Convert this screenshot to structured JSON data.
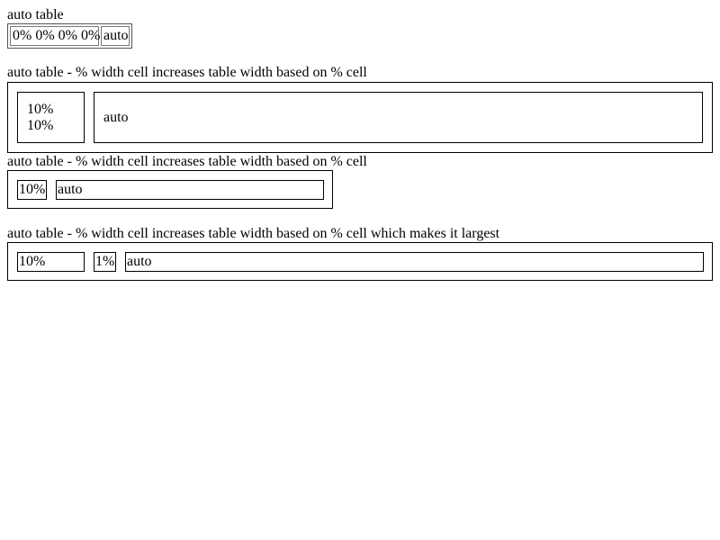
{
  "sections": [
    {
      "caption": "auto table",
      "cells": [
        "0% 0% 0% 0%",
        "auto"
      ]
    },
    {
      "caption": "auto table - % width cell increases table width based on % cell",
      "cells": [
        "10%",
        "10%",
        "auto"
      ]
    },
    {
      "caption": "auto table - % width cell increases table width based on % cell",
      "cells": [
        "10%",
        "auto"
      ]
    },
    {
      "caption": "auto table - % width cell increases table width based on % cell which makes it largest",
      "cells": [
        "10%",
        "1%",
        "auto"
      ]
    }
  ]
}
